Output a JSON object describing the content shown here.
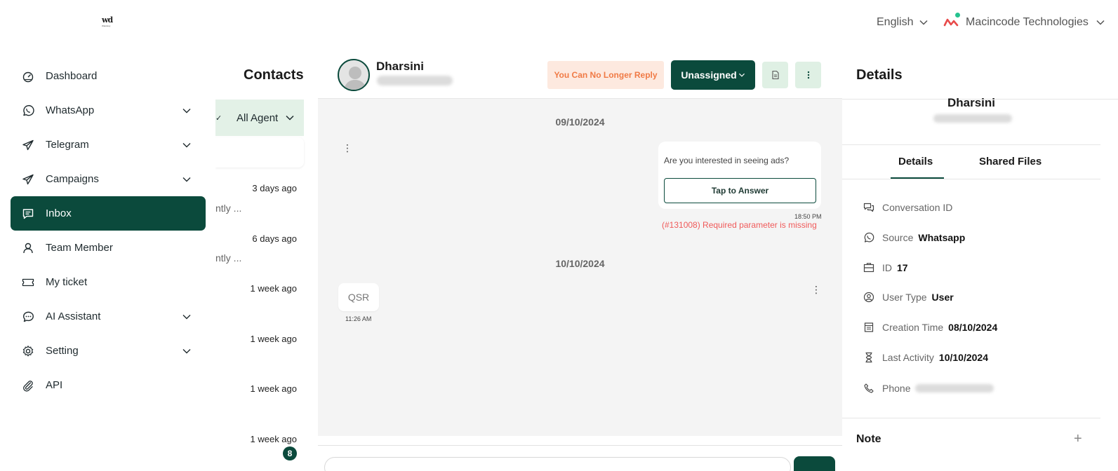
{
  "topbar": {
    "logo_text": "wd",
    "logo_sub": "Watsboty",
    "language": "English",
    "organization": "Macincode Technologies"
  },
  "sidebar": {
    "items": [
      {
        "label": "Dashboard",
        "icon": "dashboard-icon",
        "has_submenu": false,
        "active": false
      },
      {
        "label": "WhatsApp",
        "icon": "whatsapp-icon",
        "has_submenu": true,
        "active": false
      },
      {
        "label": "Telegram",
        "icon": "telegram-icon",
        "has_submenu": true,
        "active": false
      },
      {
        "label": "Campaigns",
        "icon": "campaigns-icon",
        "has_submenu": true,
        "active": false
      },
      {
        "label": "Inbox",
        "icon": "inbox-icon",
        "has_submenu": false,
        "active": true
      },
      {
        "label": "Team Member",
        "icon": "team-member-icon",
        "has_submenu": false,
        "active": false
      },
      {
        "label": "My ticket",
        "icon": "ticket-icon",
        "has_submenu": false,
        "active": false
      },
      {
        "label": "AI Assistant",
        "icon": "ai-assistant-icon",
        "has_submenu": true,
        "active": false
      },
      {
        "label": "Setting",
        "icon": "setting-icon",
        "has_submenu": true,
        "active": false
      },
      {
        "label": "API",
        "icon": "api-icon",
        "has_submenu": false,
        "active": false
      }
    ]
  },
  "contacts": {
    "title": "Contacts",
    "filter_check": "✓",
    "filter_label": "All Agent",
    "items": [
      {
        "time": "3 days ago",
        "snippet": "ntly ..."
      },
      {
        "time": "6 days ago",
        "snippet": "ntly ..."
      },
      {
        "time": "1 week ago",
        "snippet": ""
      },
      {
        "time": "1 week ago",
        "snippet": ""
      },
      {
        "time": "1 week ago",
        "snippet": ""
      },
      {
        "time": "1 week ago",
        "snippet": ""
      }
    ],
    "unread_badge": "8"
  },
  "chat": {
    "contact_name": "Dharsini",
    "contact_phone_blurred": "+918056584997",
    "no_reply_label": "You Can No Longer Reply",
    "assign_label": "Unassigned",
    "dates": [
      "09/10/2024",
      "10/10/2024"
    ],
    "outgoing": {
      "question": "Are you interested in seeing ads?",
      "button": "Tap to Answer",
      "time": "18:50 PM",
      "error": "(#131008) Required parameter is missing"
    },
    "incoming": {
      "text": "QSR",
      "time": "11:26 AM"
    },
    "menu_glyph": "⋮"
  },
  "details": {
    "title": "Details",
    "name": "Dharsini",
    "tabs": [
      "Details",
      "Shared Files"
    ],
    "fields": [
      {
        "icon": "conversation-icon",
        "label": "Conversation ID",
        "value": ""
      },
      {
        "icon": "whatsapp-icon",
        "label": "Source",
        "value": "Whatsapp"
      },
      {
        "icon": "id-card-icon",
        "label": "ID",
        "value": "17"
      },
      {
        "icon": "user-circle-icon",
        "label": "User Type",
        "value": "User"
      },
      {
        "icon": "calendar-icon",
        "label": "Creation Time",
        "value": "08/10/2024"
      },
      {
        "icon": "hourglass-icon",
        "label": "Last Activity",
        "value": "10/10/2024"
      },
      {
        "icon": "phone-icon",
        "label": "Phone",
        "value": ""
      }
    ],
    "note_label": "Note",
    "note_add": "+"
  },
  "colors": {
    "primary": "#0b4a3c",
    "light_green": "#e3f1e7",
    "warning_bg": "#fde9df",
    "warning_text": "#f07a45",
    "error_text": "#f05a5a",
    "chat_bg": "#f4f4f4"
  }
}
